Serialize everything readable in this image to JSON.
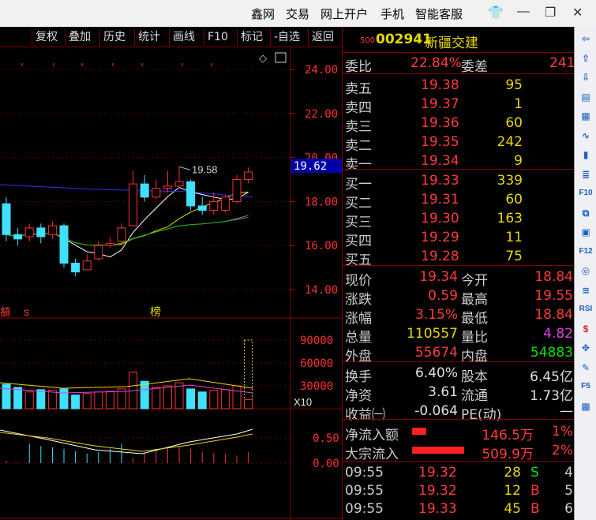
{
  "titlebar": {
    "menus": [
      "鑫网",
      "交易",
      "网上开户",
      "手机",
      "智能客服"
    ],
    "controls": {
      "shirt": "👕",
      "minimize": "—",
      "restore": "❐",
      "close": "✕"
    }
  },
  "toolbar": {
    "buttons": [
      "复权",
      "叠加",
      "历史",
      "统计",
      "画线",
      "F10",
      "标记",
      "-自选",
      "返回"
    ]
  },
  "chart_data": {
    "type": "candlestick",
    "price_axis": {
      "ticks": [
        "24.00",
        "22.00",
        "20.00",
        "18.00",
        "16.00",
        "14.00"
      ],
      "current": "19.62",
      "max_annotation": "19.58"
    },
    "volume_axis": {
      "ticks": [
        "90000",
        "60000",
        "30000"
      ],
      "unit": "X10"
    },
    "indicator_axis": {
      "ticks": [
        "0.50",
        "0.00"
      ]
    },
    "markers": [
      "s",
      "榜"
    ],
    "candles": [
      {
        "o": 17.9,
        "c": 16.5,
        "h": 18.2,
        "l": 16.2
      },
      {
        "o": 16.5,
        "c": 16.3,
        "h": 16.8,
        "l": 16.0
      },
      {
        "o": 16.4,
        "c": 16.8,
        "h": 17.0,
        "l": 16.2
      },
      {
        "o": 16.8,
        "c": 16.4,
        "h": 17.0,
        "l": 16.1
      },
      {
        "o": 16.5,
        "c": 16.9,
        "h": 17.1,
        "l": 16.3
      },
      {
        "o": 16.9,
        "c": 15.2,
        "h": 17.0,
        "l": 15.0
      },
      {
        "o": 15.2,
        "c": 14.8,
        "h": 15.4,
        "l": 14.6
      },
      {
        "o": 14.9,
        "c": 15.3,
        "h": 15.6,
        "l": 14.9
      },
      {
        "o": 15.4,
        "c": 16.0,
        "h": 16.2,
        "l": 15.3
      },
      {
        "o": 16.0,
        "c": 16.1,
        "h": 16.4,
        "l": 15.9
      },
      {
        "o": 16.2,
        "c": 16.8,
        "h": 17.0,
        "l": 16.1
      },
      {
        "o": 16.9,
        "c": 18.8,
        "h": 19.4,
        "l": 16.9
      },
      {
        "o": 18.8,
        "c": 18.2,
        "h": 19.2,
        "l": 18.0
      },
      {
        "o": 18.2,
        "c": 18.6,
        "h": 19.0,
        "l": 18.1
      },
      {
        "o": 18.6,
        "c": 18.7,
        "h": 19.4,
        "l": 18.4
      },
      {
        "o": 18.7,
        "c": 18.9,
        "h": 19.58,
        "l": 18.6
      },
      {
        "o": 18.9,
        "c": 17.8,
        "h": 19.0,
        "l": 17.6
      },
      {
        "o": 17.8,
        "c": 17.6,
        "h": 18.2,
        "l": 17.4
      },
      {
        "o": 17.6,
        "c": 18.0,
        "h": 18.4,
        "l": 17.4
      },
      {
        "o": 17.6,
        "c": 18.2,
        "h": 18.3,
        "l": 17.5
      },
      {
        "o": 18.0,
        "c": 19.0,
        "h": 19.2,
        "l": 17.9
      },
      {
        "o": 19.0,
        "c": 19.34,
        "h": 19.55,
        "l": 18.84
      }
    ],
    "volumes": [
      32000,
      28000,
      22000,
      25000,
      24000,
      26000,
      18000,
      20000,
      22000,
      23000,
      26000,
      48000,
      36000,
      28000,
      30000,
      34000,
      26000,
      22000,
      24000,
      25000,
      30000,
      90000
    ]
  },
  "quote": {
    "market_no": "500",
    "code": "002941",
    "name": "新疆交建",
    "weibi": {
      "label": "委比",
      "value": "22.84%",
      "label2": "委差",
      "value2": "241"
    },
    "asks": [
      {
        "label": "卖五",
        "price": "19.38",
        "vol": "95"
      },
      {
        "label": "卖四",
        "price": "19.37",
        "vol": "1"
      },
      {
        "label": "卖三",
        "price": "19.36",
        "vol": "60"
      },
      {
        "label": "卖二",
        "price": "19.35",
        "vol": "242"
      },
      {
        "label": "卖一",
        "price": "19.34",
        "vol": "9"
      }
    ],
    "bids": [
      {
        "label": "买一",
        "price": "19.33",
        "vol": "339"
      },
      {
        "label": "买二",
        "price": "19.31",
        "vol": "60"
      },
      {
        "label": "买三",
        "price": "19.30",
        "vol": "163"
      },
      {
        "label": "买四",
        "price": "19.29",
        "vol": "11"
      },
      {
        "label": "买五",
        "price": "19.28",
        "vol": "75"
      }
    ],
    "stats1": [
      {
        "l1": "现价",
        "v1": "19.34",
        "l2": "今开",
        "v2": "18.84"
      },
      {
        "l1": "涨跌",
        "v1": "0.59",
        "l2": "最高",
        "v2": "19.55"
      },
      {
        "l1": "涨幅",
        "v1": "3.15%",
        "l2": "最低",
        "v2": "18.84"
      },
      {
        "l1": "总量",
        "v1": "110557",
        "l2": "量比",
        "v2": "4.82"
      },
      {
        "l1": "外盘",
        "v1": "55674",
        "l2": "内盘",
        "v2": "54883"
      }
    ],
    "stats2": [
      {
        "l1": "换手",
        "v1": "6.40%",
        "l2": "股本",
        "v2": "6.45亿"
      },
      {
        "l1": "净资",
        "v1": "3.61",
        "l2": "流通",
        "v2": "1.73亿"
      },
      {
        "l1": "收益㈠",
        "v1": "-0.064",
        "l2": "PE(动)",
        "v2": "—"
      }
    ],
    "flows": [
      {
        "label": "净流入额",
        "value": "146.5万",
        "pct": "1%"
      },
      {
        "label": "大宗流入",
        "value": "509.9万",
        "pct": "2%"
      }
    ],
    "ticks": [
      {
        "time": "09:55",
        "price": "19.32",
        "vol": "28",
        "side": "S",
        "n": "4"
      },
      {
        "time": "09:55",
        "price": "19.32",
        "vol": "12",
        "side": "B",
        "n": "5"
      },
      {
        "time": "09:55",
        "price": "19.33",
        "vol": "45",
        "side": "B",
        "n": "6"
      }
    ]
  },
  "sidebar": {
    "icons": [
      "⇦",
      "⇧",
      "⇩",
      "▤",
      "▦",
      "∿",
      "▮",
      "≣",
      "F10",
      "⧉",
      "▣",
      "F12",
      "◎",
      "≋",
      "RSI",
      "$",
      "✥",
      "✎",
      "F5",
      "▩"
    ]
  }
}
